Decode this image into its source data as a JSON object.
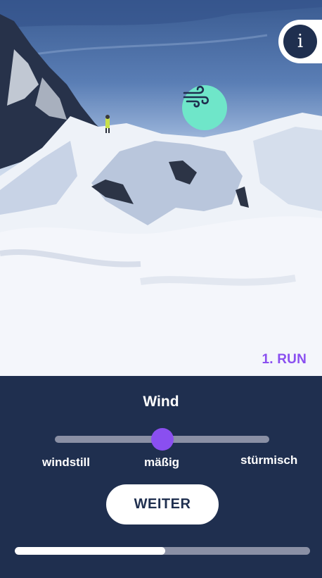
{
  "scene": {
    "run_label": "1. RUN",
    "marker_icon": "wind-icon",
    "info_icon": "info-icon",
    "info_text": "i"
  },
  "question": {
    "title": "Wind",
    "options": [
      "windstill",
      "mäßig",
      "stürmisch"
    ],
    "selected": "mäßig",
    "slider_value": 0.5
  },
  "actions": {
    "next_label": "WEITER"
  },
  "progress": {
    "fraction": 0.51
  },
  "colors": {
    "panel": "#1f2f4f",
    "accent": "#8a4ff0",
    "marker": "#6fe6c9",
    "track": "#8a90a5"
  }
}
